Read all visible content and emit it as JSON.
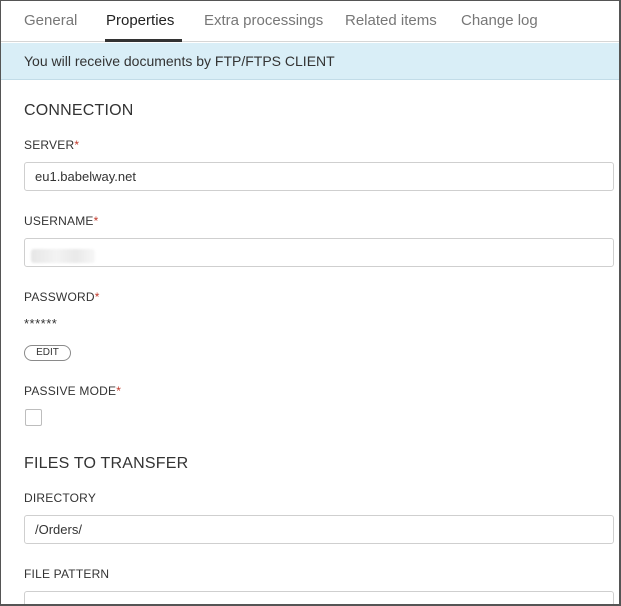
{
  "tabs": [
    {
      "label": "General",
      "active": false
    },
    {
      "label": "Properties",
      "active": true
    },
    {
      "label": "Extra processings",
      "active": false
    },
    {
      "label": "Related items",
      "active": false
    },
    {
      "label": "Change log",
      "active": false
    }
  ],
  "banner": {
    "text": "You will receive documents by FTP/FTPS CLIENT"
  },
  "connection": {
    "title": "CONNECTION",
    "server": {
      "label": "SERVER",
      "required_mark": "*",
      "value": "eu1.babelway.net"
    },
    "username": {
      "label": "USERNAME",
      "required_mark": "*",
      "value": ""
    },
    "password": {
      "label": "PASSWORD",
      "required_mark": "*",
      "masked_value": "******",
      "edit_label": "EDIT"
    },
    "passive_mode": {
      "label": "PASSIVE MODE",
      "required_mark": "*",
      "checked": false
    }
  },
  "files": {
    "title": "FILES TO TRANSFER",
    "directory": {
      "label": "DIRECTORY",
      "value": "/Orders/"
    },
    "file_pattern": {
      "label": "FILE PATTERN",
      "value": ""
    }
  }
}
